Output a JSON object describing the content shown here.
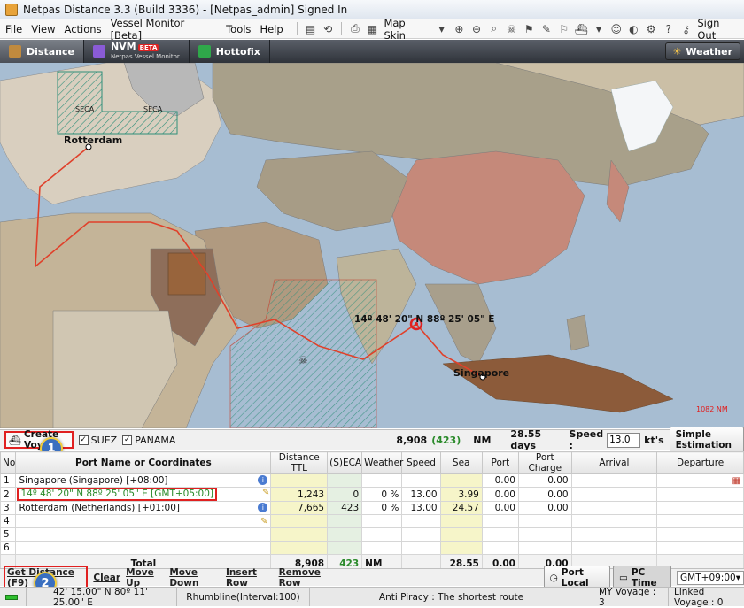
{
  "window": {
    "title": "Netpas Distance 3.3 (Build 3336) - [Netpas_admin] Signed In"
  },
  "menu": {
    "items": [
      "File",
      "View",
      "Actions",
      "Vessel Monitor [Beta]",
      "Tools",
      "Help"
    ],
    "map_skin": "Map Skin",
    "sign_out": "Sign Out"
  },
  "tabs": {
    "distance": "Distance",
    "nvm": "NVM",
    "nvm_beta": "BETA",
    "nvm_sub": "Netpas Vessel Monitor",
    "hottofix": "Hottofix",
    "weather": "Weather"
  },
  "map": {
    "labels": {
      "seca1": "SECA",
      "seca2": "SECA",
      "rotterdam": "Rotterdam",
      "singapore": "Singapore",
      "coordinate": "14º 48' 20\" N  88º 25' 05\" E",
      "scale": "1082 NM"
    }
  },
  "controls": {
    "create_voyage": "Create Voyage",
    "suez": "SUEZ",
    "panama": "PANAMA",
    "total_distance": "8,908",
    "seca_distance": "(423)",
    "unit": "NM",
    "days": "28.55 days",
    "speed_label": "Speed :",
    "speed_value": "13.0",
    "speed_unit": "kt's",
    "simple_estimation": "Simple Estimation",
    "badge1": "1",
    "badge2": "2"
  },
  "grid": {
    "headers": [
      "No",
      "Port Name or Coordinates",
      "Distance TTL",
      "(S)ECA",
      "Weather",
      "Speed",
      "Sea",
      "Port",
      "Port Charge",
      "Arrival",
      "Departure"
    ],
    "rows": [
      {
        "no": "1",
        "port": "Singapore (Singapore) [+08:00]",
        "dist": "",
        "seca": "",
        "weather": "",
        "speed": "",
        "sea": "",
        "port_days": "0.00",
        "charge": "0.00"
      },
      {
        "no": "2",
        "port": "14º 48' 20\" N  88º 25' 05\" E [GMT+05:00]",
        "dist": "1,243",
        "seca": "0",
        "weather": "0 %",
        "speed": "13.00",
        "sea": "3.99",
        "port_days": "0.00",
        "charge": "0.00"
      },
      {
        "no": "3",
        "port": "Rotterdam (Netherlands) [+01:00]",
        "dist": "7,665",
        "seca": "423",
        "weather": "0 %",
        "speed": "13.00",
        "sea": "24.57",
        "port_days": "0.00",
        "charge": "0.00"
      },
      {
        "no": "4",
        "port": "",
        "dist": "",
        "seca": "",
        "weather": "",
        "speed": "",
        "sea": "",
        "port_days": "",
        "charge": ""
      },
      {
        "no": "5",
        "port": "",
        "dist": "",
        "seca": "",
        "weather": "",
        "speed": "",
        "sea": "",
        "port_days": "",
        "charge": ""
      },
      {
        "no": "6",
        "port": "",
        "dist": "",
        "seca": "",
        "weather": "",
        "speed": "",
        "sea": "",
        "port_days": "",
        "charge": ""
      }
    ],
    "total": {
      "label": "Total",
      "dist": "8,908",
      "seca": "423",
      "unit": "NM",
      "sea": "28.55",
      "port": "0.00",
      "charge": "0.00"
    }
  },
  "bottom": {
    "get_distance": "Get Distance (F9)",
    "clear": "Clear",
    "move_up": "Move Up",
    "move_down": "Move Down",
    "insert_row": "Insert Row",
    "remove_row": "Remove Row",
    "port_local": "Port Local",
    "pc_time": "PC Time",
    "timezone": "GMT+09:00"
  },
  "status": {
    "coords": "42' 15.00\" N  80º 11' 25.00\" E",
    "mode": "Rhumbline(Interval:100)",
    "anti_piracy": "Anti Piracy : The shortest route",
    "my_voyage": "MY Voyage : 3",
    "linked_voyage": "Linked Voyage : 0"
  },
  "colors": {
    "route": "#e0402a",
    "seca_hatch": "#2f8f7a",
    "highlight_red": "#e02020",
    "accent_blue": "#3a6fc0"
  }
}
